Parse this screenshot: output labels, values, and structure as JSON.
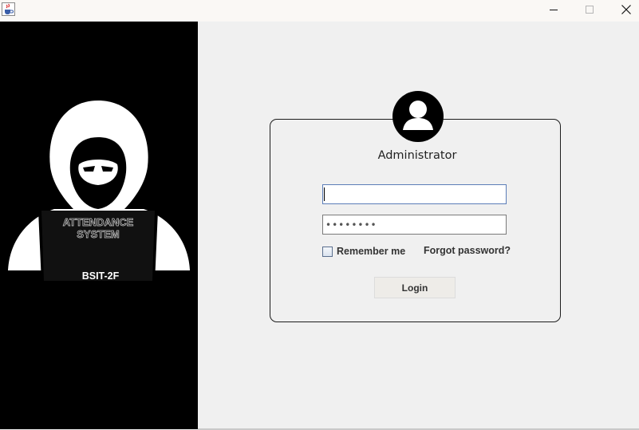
{
  "window": {
    "minimize_glyph": "—",
    "maximize_glyph": "☐",
    "close_glyph": "✕"
  },
  "branding": {
    "system_line1": "ATTENDANCE",
    "system_line2": "SYSTEM",
    "section": "BSIT-2F"
  },
  "login": {
    "role": "Administrator",
    "username_value": "",
    "password_value": "••••••••",
    "remember_label": "Remember me",
    "remember_checked": false,
    "forgot_label": "Forgot password?",
    "login_label": "Login"
  },
  "icons": {
    "app": "java-cup-icon",
    "avatar": "user-avatar-icon",
    "hero": "hooded-hacker-illustration"
  }
}
